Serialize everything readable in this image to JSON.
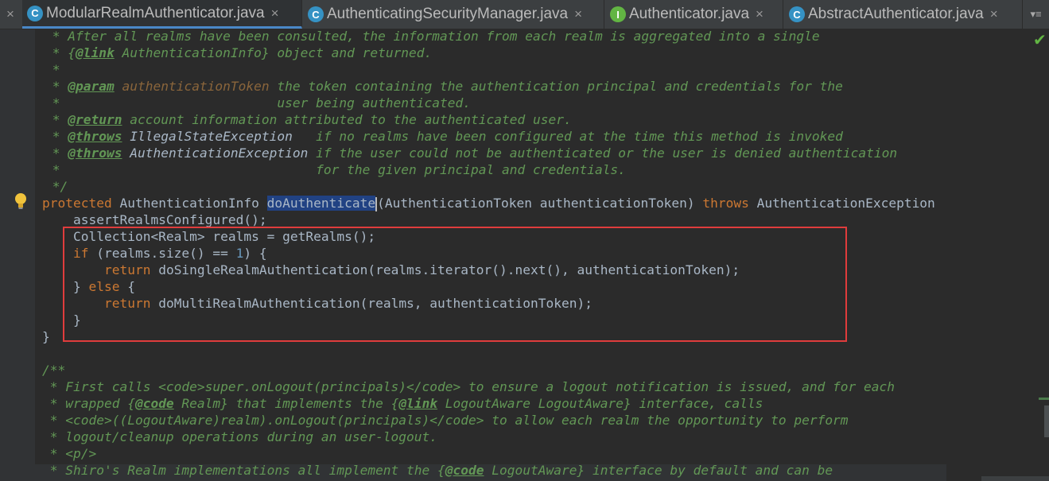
{
  "tabs": [
    {
      "label": "ModularRealmAuthenticator.java",
      "icon": "class-icon",
      "icon_letter": "C",
      "active": true
    },
    {
      "label": "AuthenticatingSecurityManager.java",
      "icon": "class-icon",
      "icon_letter": "C",
      "active": false
    },
    {
      "label": "Authenticator.java",
      "icon": "interface-icon",
      "icon_letter": "I",
      "active": false
    },
    {
      "label": "AbstractAuthenticator.java",
      "icon": "class-icon",
      "icon_letter": "C",
      "active": false
    }
  ],
  "tabs_menu": "▾≡",
  "close_glyph": "×",
  "code": {
    "l1_a": " * After all realms have been consulted, the information from each realm is aggregated into a single",
    "l2_a": " * {",
    "l2_tag": "@link",
    "l2_b": " AuthenticationInfo} object and returned.",
    "l3": " *",
    "l4_a": " * ",
    "l4_tag": "@param",
    "l4_p": " authenticationToken",
    "l4_b": " the token containing the authentication principal and credentials for the",
    "l5": " *                            user being authenticated.",
    "l6_a": " * ",
    "l6_tag": "@return",
    "l6_b": " account information attributed to the authenticated user.",
    "l7_a": " * ",
    "l7_tag": "@throws",
    "l7_cls": " IllegalStateException",
    "l7_b": "   if no realms have been configured at the time this method is invoked",
    "l8_a": " * ",
    "l8_tag": "@throws",
    "l8_cls": " AuthenticationException",
    "l8_b": " if the user could not be authenticated or the user is denied authentication",
    "l9": " *                                 for the given principal and credentials.",
    "l10": " */",
    "l11_kw": "protected",
    "l11_a": " AuthenticationInfo ",
    "l11_sel": "doAuthenticate",
    "l11_b": "(AuthenticationToken authenticationToken) ",
    "l11_kw2": "throws",
    "l11_c": " AuthenticationException",
    "l12": "    assertRealmsConfigured();",
    "l13": "    Collection<Realm> realms = getRealms();",
    "l14_kw": "    if",
    "l14_a": " (realms.size() == ",
    "l14_num": "1",
    "l14_b": ") {",
    "l15_kw": "        return",
    "l15_a": " doSingleRealmAuthentication(realms.iterator().next(), authenticationToken);",
    "l16_a": "    } ",
    "l16_kw": "else",
    "l16_b": " {",
    "l17_kw": "        return",
    "l17_a": " doMultiRealmAuthentication(realms, authenticationToken);",
    "l18": "    }",
    "l19": "}",
    "l20": "",
    "l21": "/**",
    "l22": " * First calls <code>super.onLogout(principals)</code> to ensure a logout notification is issued, and for each",
    "l23_a": " * wrapped {",
    "l23_tag": "@code",
    "l23_b": " Realm} that implements the {",
    "l23_tag2": "@link",
    "l23_c": " LogoutAware LogoutAware} interface, calls",
    "l24": " * <code>((LogoutAware)realm).onLogout(principals)</code> to allow each realm the opportunity to perform",
    "l25": " * logout/cleanup operations during an user-logout.",
    "l26": " * <p/>",
    "l27_a": " * Shiro's Realm implementations all implement the {",
    "l27_tag": "@code",
    "l27_b": " LogoutAware} interface by default and can be"
  },
  "colors": {
    "background": "#2b2b2b",
    "comment": "#629755",
    "keyword": "#cc7832",
    "highlight_box": "#e03c3c",
    "selection": "#214283"
  }
}
